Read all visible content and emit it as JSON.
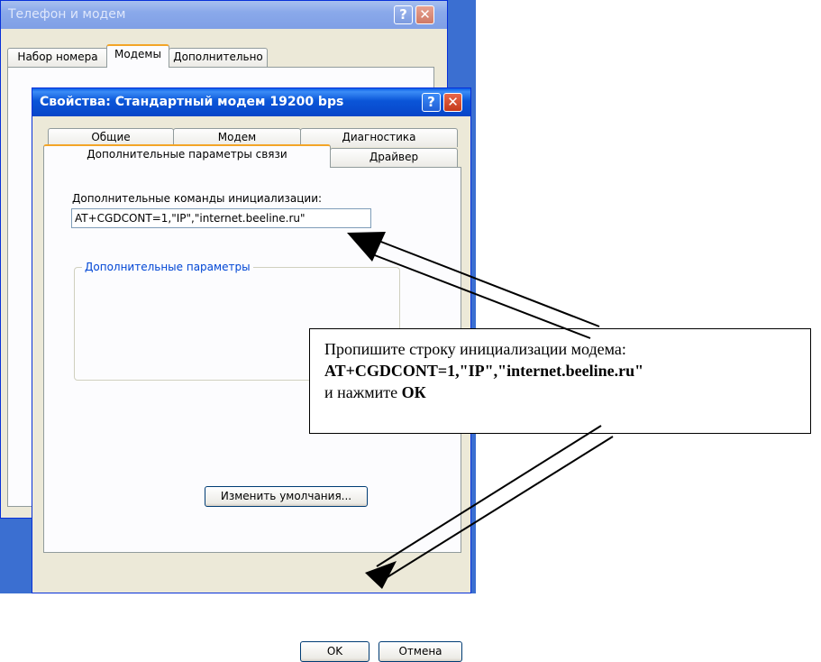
{
  "background_window": {
    "title": "Телефон и модем",
    "tabs": [
      "Набор номера",
      "Модемы",
      "Дополнительно"
    ],
    "active_tab": "Модемы"
  },
  "dialog": {
    "title": "Свойства: Стандартный модем 19200 bps",
    "tabs_row1": [
      "Общие",
      "Модем",
      "Диагностика"
    ],
    "tabs_row2": [
      "Дополнительные параметры связи",
      "Драйвер"
    ],
    "active_tab": "Дополнительные параметры связи",
    "group_label": "Дополнительные параметры",
    "field_label": "Дополнительные команды инициализации:",
    "field_value": "AT+CGDCONT=1,\"IP\",\"internet.beeline.ru\"",
    "defaults_button": "Изменить умолчания...",
    "ok_button": "OK",
    "cancel_button": "Отмена"
  },
  "title_buttons": {
    "help": "?",
    "close": "✕"
  },
  "callout": {
    "line1": "Пропишите строку инициализации модема:",
    "line2": "AT+CGDCONT=1,\"IP\",\"internet.beeline.ru\"",
    "line3_prefix": "и нажмите ",
    "line3_bold": "ОК"
  },
  "colors": {
    "desktop": "#3b6fd1",
    "titlebar_active": "#0a55d8",
    "dialog_face": "#ece9d8",
    "tab_highlight": "#f3a527",
    "group_label": "#0046d5"
  }
}
